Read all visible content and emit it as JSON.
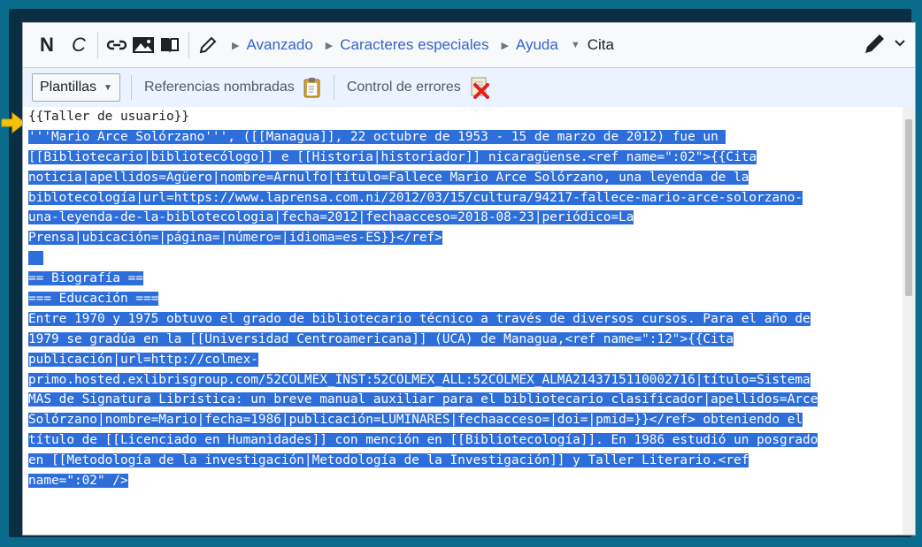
{
  "toolbar": {
    "bold": "N",
    "italic": "C",
    "menus": [
      {
        "label": "Avanzado"
      },
      {
        "label": "Caracteres especiales"
      },
      {
        "label": "Ayuda"
      },
      {
        "label": "Cita"
      }
    ]
  },
  "toolbar2": {
    "templates": "Plantillas",
    "named_refs": "Referencias nombradas",
    "error_check": "Control de errores"
  },
  "editor": {
    "lines": [
      {
        "text": "{{Taller de usuario}}",
        "selected": false
      },
      {
        "text": "'''Mario Arce Solórzano''', ([[Managua]], 22 octubre de 1953 - 15 de marzo de 2012) fue un ",
        "selected": true
      },
      {
        "text": "[[Bibliotecario|bibliotecólogo]] e [[Historia|historiador]] nicaragüense.<ref name=\":02\">{{Cita",
        "selected": true
      },
      {
        "text": "noticia|apellidos=Agüero|nombre=Arnulfo|título=Fallece Mario Arce Solórzano, una leyenda de la",
        "selected": true
      },
      {
        "text": "biblotecología|url=https://www.laprensa.com.ni/2012/03/15/cultura/94217-fallece-mario-arce-solorzano-",
        "selected": true
      },
      {
        "text": "una-leyenda-de-la-biblotecologia|fecha=2012|fechaacceso=2018-08-23|periódico=La",
        "selected": true
      },
      {
        "text": "Prensa|ubicación=|página=|número=|idioma=es-ES}}</ref>",
        "selected": true
      },
      {
        "text": "  ",
        "selected": true
      },
      {
        "text": "== Biografía ==",
        "selected": true
      },
      {
        "text": "=== Educación ===",
        "selected": true
      },
      {
        "text": "Entre 1970 y 1975 obtuvo el grado de bibliotecario técnico a través de diversos cursos. Para el año de",
        "selected": true
      },
      {
        "text": "1979 se gradúa en la [[Universidad Centroamericana]] (UCA) de Managua,<ref name=\":12\">{{Cita",
        "selected": true
      },
      {
        "text": "publicación|url=http://colmex-",
        "selected": true
      },
      {
        "text": "primo.hosted.exlibrisgroup.com/52COLMEX_INST:52COLMEX_ALL:52COLMEX_ALMA2143715110002716|título=Sistema",
        "selected": true
      },
      {
        "text": "MAS de Signatura Librística: un breve manual auxiliar para el bibliotecario clasificador|apellidos=Arce",
        "selected": true
      },
      {
        "text": "Solórzano|nombre=Mario|fecha=1986|publicación=LUMINARES|fechaacceso=|doi=|pmid=}}</ref> obteniendo el",
        "selected": true
      },
      {
        "text": "título de [[Licenciado en Humanidades]] con mención en [[Bibliotecología]]. En 1986 estudió un posgrado",
        "selected": true
      },
      {
        "text": "en [[Metodología de la investigación|Metodología de la Investigación]] y Taller Literario.<ref",
        "selected": true
      },
      {
        "text": "name=\":02\" />",
        "selected": true
      }
    ]
  },
  "colors": {
    "selection": "#2d6edb",
    "link": "#3366cc",
    "arrow": "#f4c20d"
  }
}
